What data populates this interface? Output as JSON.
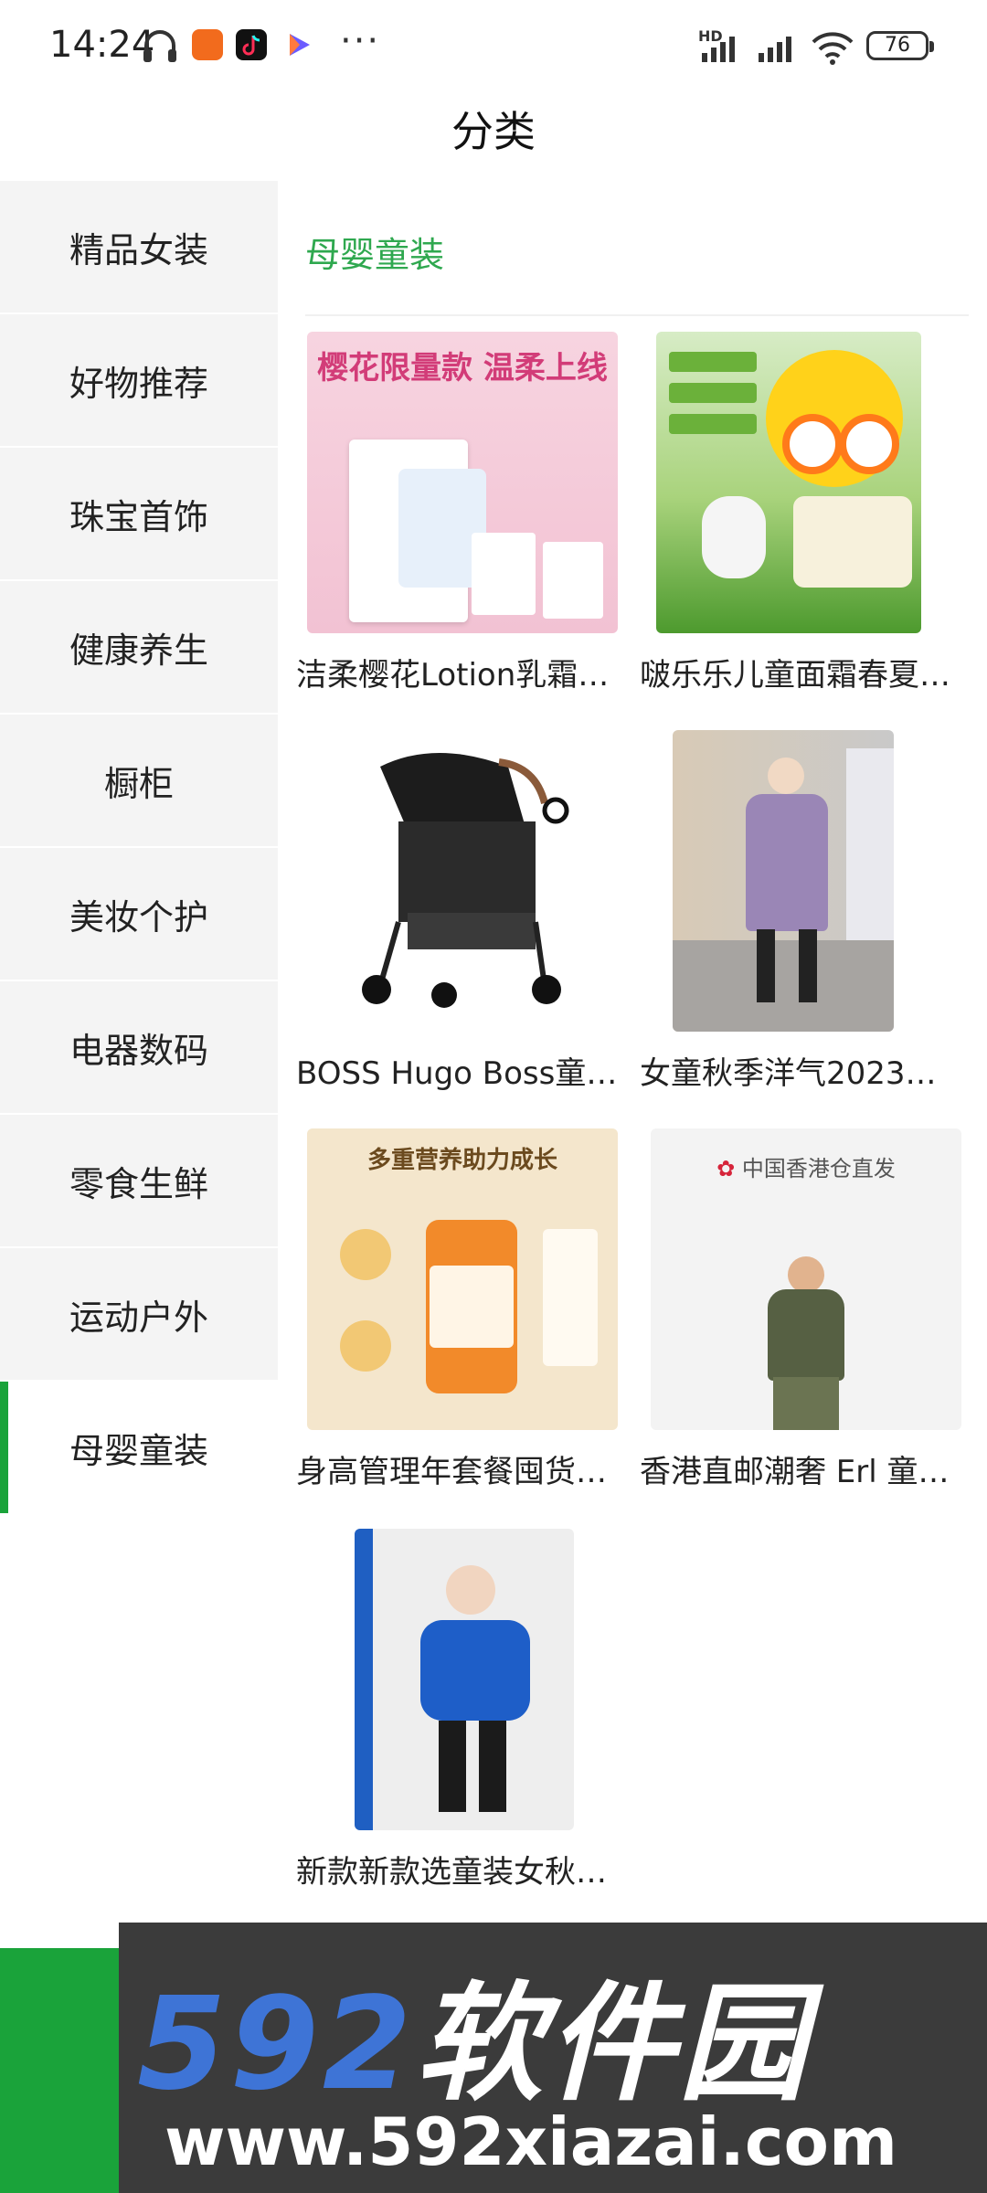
{
  "status_bar": {
    "time": "14:24",
    "more": "···",
    "battery": "76",
    "hd": "HD"
  },
  "header": {
    "title": "分类"
  },
  "sidebar": {
    "items": [
      {
        "label": "精品女装"
      },
      {
        "label": "好物推荐"
      },
      {
        "label": "珠宝首饰"
      },
      {
        "label": "健康养生"
      },
      {
        "label": "橱柜"
      },
      {
        "label": "美妆个护"
      },
      {
        "label": "电器数码"
      },
      {
        "label": "零食生鲜"
      },
      {
        "label": "运动户外"
      },
      {
        "label": "母婴童装"
      }
    ],
    "active": "母婴童装"
  },
  "content": {
    "section_title": "母婴童装",
    "products": [
      {
        "title": "洁柔樱花Lotion乳霜…",
        "image_text": "樱花限量款 温柔上线"
      },
      {
        "title": "啵乐乐儿童面霜春夏…"
      },
      {
        "title": "BOSS Hugo Boss童…"
      },
      {
        "title": "女童秋季洋气2023…"
      },
      {
        "title": "身高管理年套餐囤货…",
        "image_text": "多重营养助力成长"
      },
      {
        "title": "香港直邮潮奢 Erl 童…",
        "image_text": "中国香港仓直发"
      },
      {
        "title": "新款新款选童装女秋…"
      }
    ]
  },
  "watermark": {
    "main_num": "592",
    "main_text": "软件园",
    "url": "www.592xiazai.com"
  }
}
